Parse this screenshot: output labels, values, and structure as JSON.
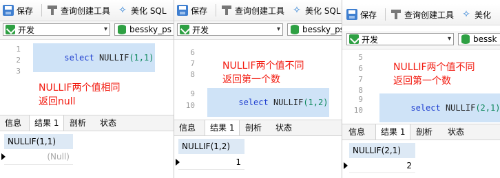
{
  "toolbar": {
    "save_label": "保存",
    "query_builder_label": "查询创建工具",
    "beautify_label": "美化 SQL",
    "beautify_short": "美化"
  },
  "connection": {
    "selected": "开发",
    "database_full": "bessky_ps",
    "database_short": "bessky_pss",
    "database_clip": "bessk"
  },
  "tabs": [
    "信息",
    "结果 1",
    "剖析",
    "状态"
  ],
  "panels": [
    {
      "line_numbers": [
        "1",
        "2",
        "3"
      ],
      "sql": {
        "keyword": "select",
        "func": "NULLIF",
        "args": "(1,1)"
      },
      "annotation": [
        "NULLIF两个值相同",
        "返回null"
      ],
      "result_column": "NULLIF(1,1)",
      "result_value": "(Null)"
    },
    {
      "line_numbers": [
        "6",
        "7",
        "8",
        "9",
        "10"
      ],
      "sql": {
        "keyword": "select",
        "func": "NULLIF",
        "args": "(1,2)"
      },
      "annotation": [
        "NULLIF两个值不同",
        "返回第一个数"
      ],
      "result_column": "NULLIF(1,2)",
      "result_value": "1"
    },
    {
      "line_numbers": [
        "5",
        "6",
        "7",
        "8",
        "9",
        "10"
      ],
      "sql": {
        "keyword": "select",
        "func": "NULLIF",
        "args": "(2,1)"
      },
      "annotation": [
        "NULLIF两个值不同",
        "返回第一个数"
      ],
      "result_column": "NULLIF(2,1)",
      "result_value": "2"
    }
  ]
}
